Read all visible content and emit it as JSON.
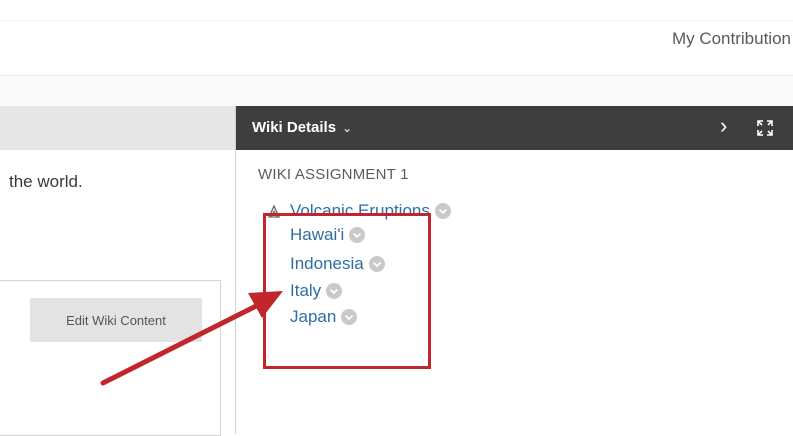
{
  "topbar": {
    "my_contributions": "My Contribution"
  },
  "left": {
    "intro_text": "the world.",
    "edit_button_label": "Edit Wiki Content"
  },
  "panel": {
    "title": "Wiki Details",
    "title_chevron": "⌄",
    "next_icon": "›",
    "assignment_title": "WIKI ASSIGNMENT 1",
    "page": {
      "label": "Volcanic Eruptions",
      "icon": "pages-icon"
    },
    "subpages": [
      {
        "label": "Hawai'i"
      },
      {
        "label": "Indonesia"
      },
      {
        "label": "Italy"
      },
      {
        "label": "Japan"
      }
    ]
  },
  "colors": {
    "header_bg": "#3e3e3e",
    "link": "#2e6ea4",
    "annotation": "#c0262c",
    "button_bg": "#e3e3e3"
  }
}
